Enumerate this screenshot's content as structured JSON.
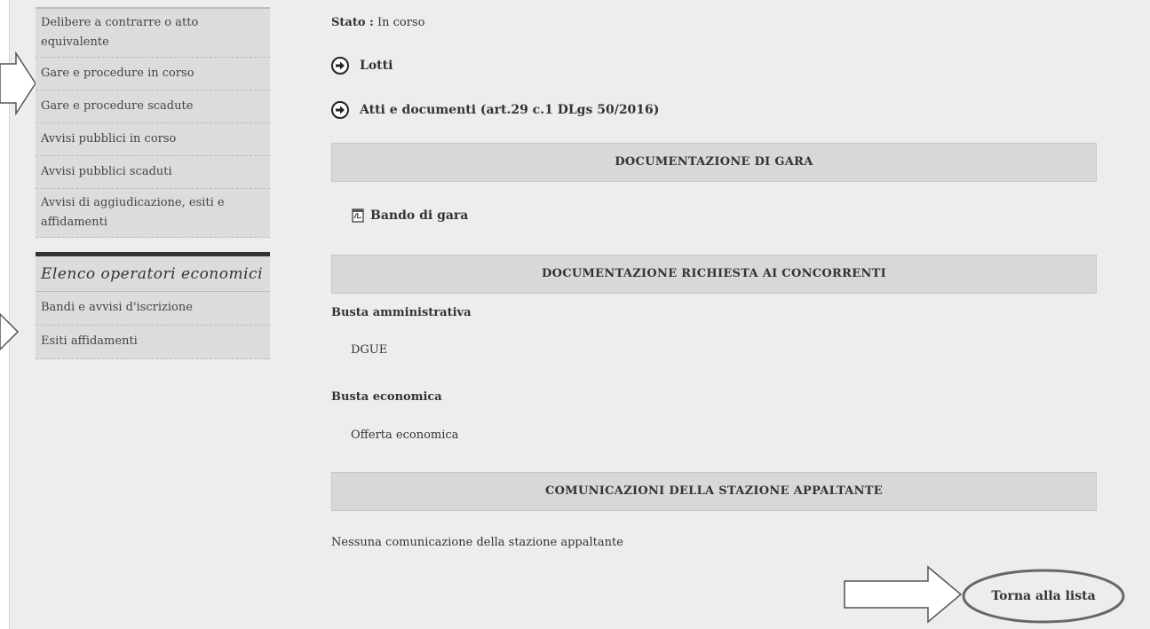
{
  "sidebar": {
    "items": [
      {
        "label": "Delibere a contrarre o atto equivalente"
      },
      {
        "label": "Gare e procedure in corso"
      },
      {
        "label": "Gare e procedure scadute"
      },
      {
        "label": "Avvisi pubblici in corso"
      },
      {
        "label": "Avvisi pubblici scaduti"
      },
      {
        "label": "Avvisi di aggiudicazione, esiti e affidamenti"
      }
    ],
    "section_title": "Elenco operatori economici",
    "section_items": [
      {
        "label": "Bandi e avvisi d'iscrizione"
      },
      {
        "label": "Esiti affidamenti"
      }
    ]
  },
  "main": {
    "stato_label": "Stato :",
    "stato_value": "In corso",
    "links": [
      {
        "label": "Lotti",
        "icon": "arrow-circle-right-icon"
      },
      {
        "label": "Atti e documenti (art.29 c.1 DLgs 50/2016)",
        "icon": "arrow-circle-right-icon"
      }
    ],
    "sections": {
      "documentazione_gara": "DOCUMENTAZIONE DI GARA",
      "documentazione_concorrenti": "DOCUMENTAZIONE RICHIESTA AI CONCORRENTI",
      "comunicazioni": "COMUNICAZIONI DELLA STAZIONE APPALTANTE"
    },
    "bando": {
      "label": "Bando di gara",
      "icon": "pdf-icon"
    },
    "busta_amministrativa": {
      "label": "Busta amministrativa",
      "item": "DGUE"
    },
    "busta_economica": {
      "label": "Busta economica",
      "item": "Offerta economica"
    },
    "no_comunicazioni": "Nessuna comunicazione della stazione appaltante",
    "back_button": "Torna alla lista"
  },
  "colors": {
    "page_bg": "#ededed",
    "sidebar_bg": "#dcdcdc",
    "section_bg": "#d8d8d8",
    "dark_bar": "#333333"
  }
}
